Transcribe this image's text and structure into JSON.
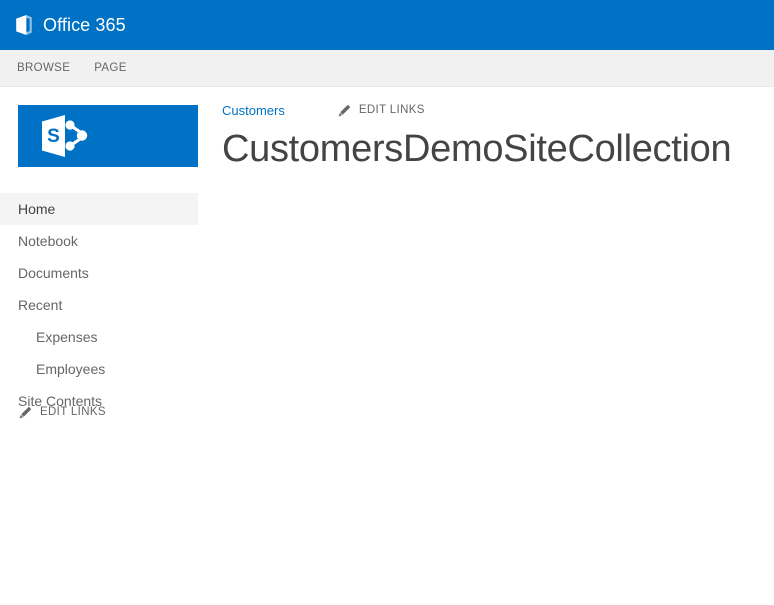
{
  "suite_bar": {
    "brand": "Office 365",
    "logo_icon": "office-logo-icon",
    "background_color": "#0072c6"
  },
  "ribbon": {
    "tabs": [
      {
        "label": "BROWSE"
      },
      {
        "label": "PAGE"
      }
    ],
    "background_color": "#f1f1f1"
  },
  "site_logo": {
    "icon": "sharepoint-logo-icon",
    "letter": "S",
    "background_color": "#0072c6"
  },
  "quick_launch": {
    "items": [
      {
        "label": "Home",
        "selected": true,
        "level": 0
      },
      {
        "label": "Notebook",
        "selected": false,
        "level": 0
      },
      {
        "label": "Documents",
        "selected": false,
        "level": 0
      },
      {
        "label": "Recent",
        "selected": false,
        "level": 0
      },
      {
        "label": "Expenses",
        "selected": false,
        "level": 1
      },
      {
        "label": "Employees",
        "selected": false,
        "level": 1
      },
      {
        "label": "Site Contents",
        "selected": false,
        "level": 0
      }
    ],
    "edit_links_label": "EDIT LINKS",
    "edit_links_icon": "pencil-icon",
    "selected_background_color": "#f4f4f4"
  },
  "main": {
    "breadcrumb": "Customers",
    "breadcrumb_color": "#0072c6",
    "edit_links_label": "EDIT LINKS",
    "edit_links_icon": "pencil-icon",
    "page_title": "CustomersDemoSiteCollection"
  }
}
